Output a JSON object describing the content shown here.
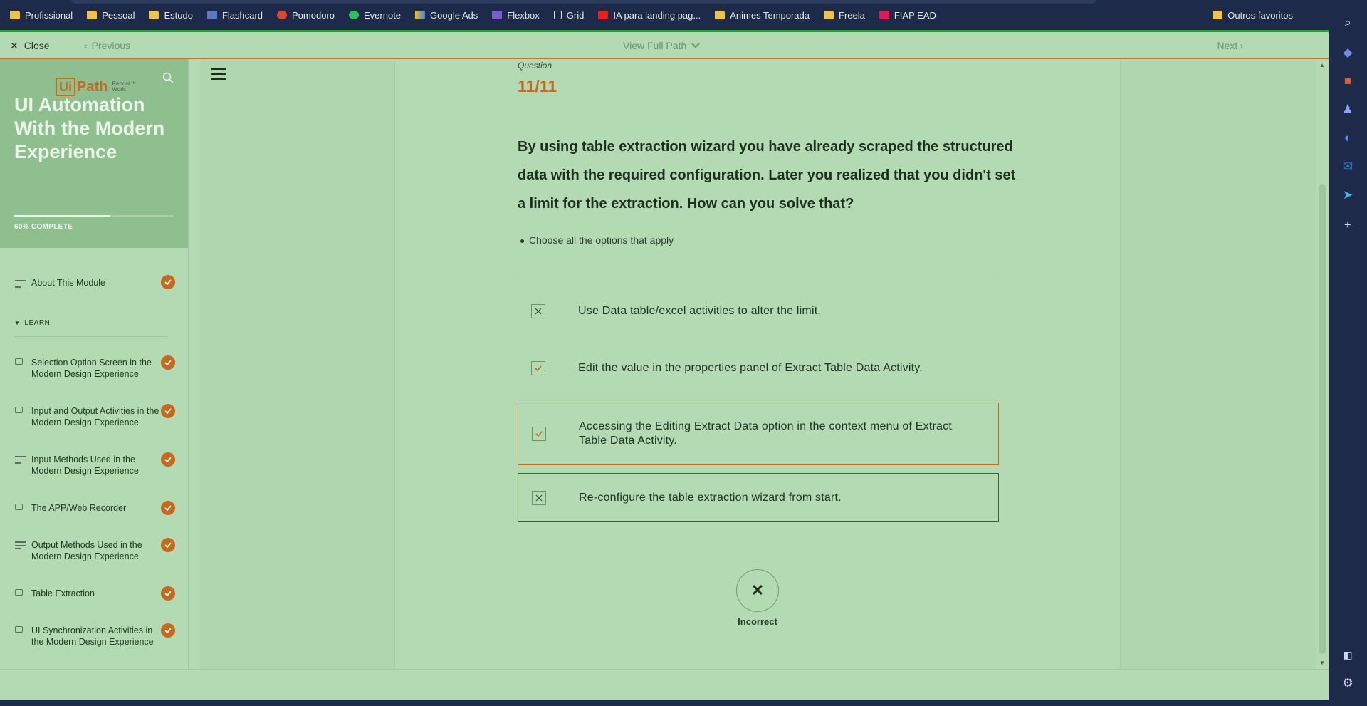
{
  "bookmarks": [
    {
      "label": "Profissional",
      "icon": "folder-icon"
    },
    {
      "label": "Pessoal",
      "icon": "folder-icon"
    },
    {
      "label": "Estudo",
      "icon": "folder-icon"
    },
    {
      "label": "Flashcard",
      "icon": "flashcard-icon"
    },
    {
      "label": "Pomodoro",
      "icon": "tomato-icon"
    },
    {
      "label": "Evernote",
      "icon": "evernote-icon"
    },
    {
      "label": "Google Ads",
      "icon": "google-ads-icon"
    },
    {
      "label": "Flexbox",
      "icon": "flexbox-icon"
    },
    {
      "label": "Grid",
      "icon": "page-icon"
    },
    {
      "label": "IA para landing pag...",
      "icon": "youtube-icon"
    },
    {
      "label": "Animes Temporada",
      "icon": "folder-icon"
    },
    {
      "label": "Freela",
      "icon": "folder-icon"
    },
    {
      "label": "FIAP EAD",
      "icon": "fiap-icon"
    }
  ],
  "bookmarks_other": "Outros favoritos",
  "nav": {
    "close": "Close",
    "previous": "Previous",
    "full_path": "View Full Path",
    "next": "Next"
  },
  "sidebar": {
    "logo_main": "Ui",
    "logo_path": "Path",
    "logo_tag": "Reboot™ Work.",
    "course_title": "UI Automation With the Modern Experience",
    "progress_label": "60% COMPLETE",
    "progress_fraction": 0.6,
    "section": "LEARN",
    "items": [
      {
        "label": "About This Module",
        "type": "text"
      },
      {
        "label": "Selection Option Screen in the Modern Design Experience",
        "type": "video"
      },
      {
        "label": "Input and Output Activities in the Modern Design Experience",
        "type": "video"
      },
      {
        "label": "Input Methods Used in the Modern Design Experience",
        "type": "text"
      },
      {
        "label": "The APP/Web Recorder",
        "type": "video"
      },
      {
        "label": "Output Methods Used in the Modern Design Experience",
        "type": "text"
      },
      {
        "label": "Table Extraction",
        "type": "video"
      },
      {
        "label": "UI Synchronization Activities in the Modern Design Experience",
        "type": "video"
      }
    ]
  },
  "question": {
    "label": "Question",
    "number": "11/11",
    "text": "By using table extraction wizard you have already scraped the structured data with the required configuration. Later you realized that you didn't set a limit for the extraction. How can you solve that?",
    "instruction": "Choose all the options that apply",
    "options": [
      {
        "text": "Use Data table/excel activities to alter the limit.",
        "mark": "cross"
      },
      {
        "text": "Edit the value in the properties panel of Extract Table Data Activity.",
        "mark": "check"
      },
      {
        "text": "Accessing the Editing Extract Data option in the context menu of Extract Table Data Activity.",
        "mark": "check"
      },
      {
        "text": "Re-configure the table extraction wizard from start.",
        "mark": "cross"
      }
    ],
    "result_symbol": "✕",
    "result_label": "Incorrect"
  },
  "colors": {
    "accent": "#c4691e",
    "background": "#b3dab3",
    "browser_chrome": "#1e2a4a"
  }
}
